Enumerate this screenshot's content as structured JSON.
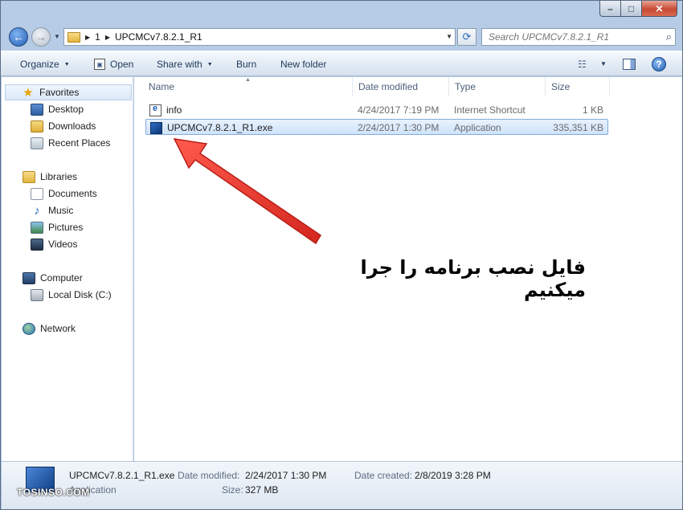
{
  "nav": {
    "breadcrumb": [
      "1",
      "UPCMCv7.8.2.1_R1"
    ],
    "search_placeholder": "Search UPCMCv7.8.2.1_R1"
  },
  "toolbar": {
    "organize": "Organize",
    "open": "Open",
    "share_with": "Share with",
    "burn": "Burn",
    "new_folder": "New folder"
  },
  "sidebar": {
    "favorites": "Favorites",
    "desktop": "Desktop",
    "downloads": "Downloads",
    "recent_places": "Recent Places",
    "libraries": "Libraries",
    "documents": "Documents",
    "music": "Music",
    "pictures": "Pictures",
    "videos": "Videos",
    "computer": "Computer",
    "local_disk": "Local Disk (C:)",
    "network": "Network"
  },
  "columns": {
    "name": "Name",
    "date_modified": "Date modified",
    "type": "Type",
    "size": "Size"
  },
  "files": [
    {
      "name": "info",
      "date": "4/24/2017 7:19 PM",
      "type": "Internet Shortcut",
      "size": "1 KB",
      "icon": "internet-shortcut-icon"
    },
    {
      "name": "UPCMCv7.8.2.1_R1.exe",
      "date": "2/24/2017 1:30 PM",
      "type": "Application",
      "size": "335,351 KB",
      "icon": "application-icon",
      "selected": true
    }
  ],
  "annotation": {
    "text": "فایل نصب برنامه را جرا میکنیم",
    "arrow_color": "#e8372f"
  },
  "details": {
    "filename": "UPCMCv7.8.2.1_R1.exe",
    "type": "Application",
    "date_modified_label": "Date modified:",
    "date_modified": "2/24/2017 1:30 PM",
    "size_label": "Size:",
    "size": "327 MB",
    "date_created_label": "Date created:",
    "date_created": "2/8/2019 3:28 PM"
  },
  "watermark": "TOSINSO.COM"
}
